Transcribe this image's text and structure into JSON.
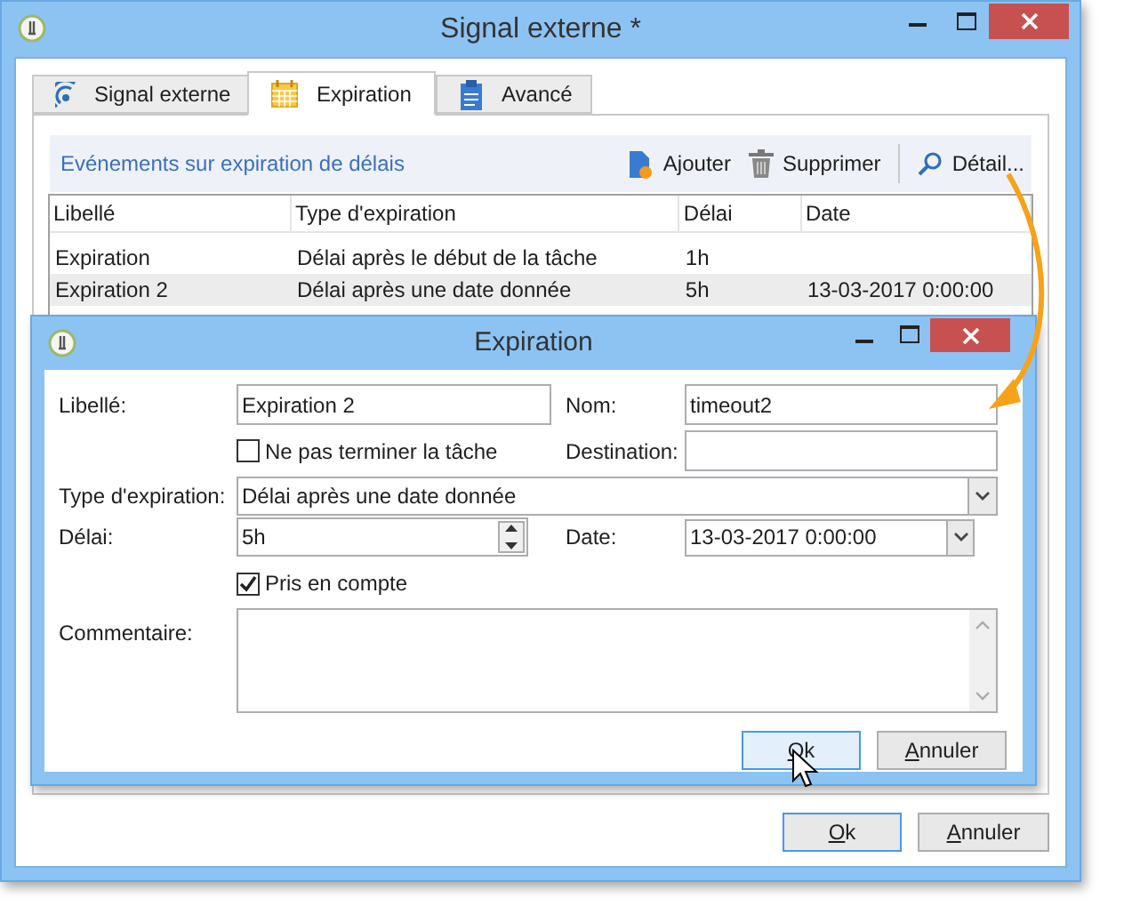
{
  "window": {
    "title": "Signal externe *"
  },
  "tabs": [
    {
      "label": "Signal externe",
      "kind": "signal",
      "selected": false
    },
    {
      "label": "Expiration",
      "kind": "calendar",
      "selected": true
    },
    {
      "label": "Avancé",
      "kind": "clipboard",
      "selected": false
    }
  ],
  "toolbar": {
    "title": "Evénements sur expiration de délais",
    "buttons": [
      {
        "label": "Ajouter",
        "kind": "add"
      },
      {
        "label": "Supprimer",
        "kind": "delete"
      },
      {
        "label": "Détail...",
        "kind": "detail"
      }
    ]
  },
  "table": {
    "columns": [
      "Libellé",
      "Type d'expiration",
      "Délai",
      "Date"
    ],
    "rows": [
      {
        "cells": [
          "Expiration",
          "Délai après le début de la tâche",
          "1h",
          ""
        ],
        "selected": false
      },
      {
        "cells": [
          "Expiration 2",
          "Délai après une date donnée",
          "5h",
          "13-03-2017 0:00:00"
        ],
        "selected": true
      }
    ]
  },
  "dialog": {
    "title": "Expiration",
    "libelle": {
      "label": "Libellé:",
      "value": "Expiration 2"
    },
    "nom": {
      "label": "Nom:",
      "value": "timeout2"
    },
    "ne_pas_terminer": {
      "label": "Ne pas terminer la tâche",
      "checked": false
    },
    "destination": {
      "label": "Destination:"
    },
    "type_expiration": {
      "label": "Type d'expiration:",
      "value": "Délai après une date donnée"
    },
    "delai": {
      "label": "Délai:",
      "value": "5h"
    },
    "date": {
      "label": "Date:",
      "value": "13-03-2017 0:00:00"
    },
    "pris_en_compte": {
      "label": "Pris en compte",
      "checked": true
    },
    "commentaire": {
      "label": "Commentaire:"
    },
    "buttons": [
      {
        "label": "Ok",
        "hovered": true,
        "default": true
      },
      {
        "label": "Annuler",
        "hovered": false,
        "default": false
      }
    ]
  },
  "buttons": [
    {
      "label": "Ok",
      "hovered": false,
      "default": true
    },
    {
      "label": "Annuler",
      "hovered": false,
      "default": false
    }
  ]
}
